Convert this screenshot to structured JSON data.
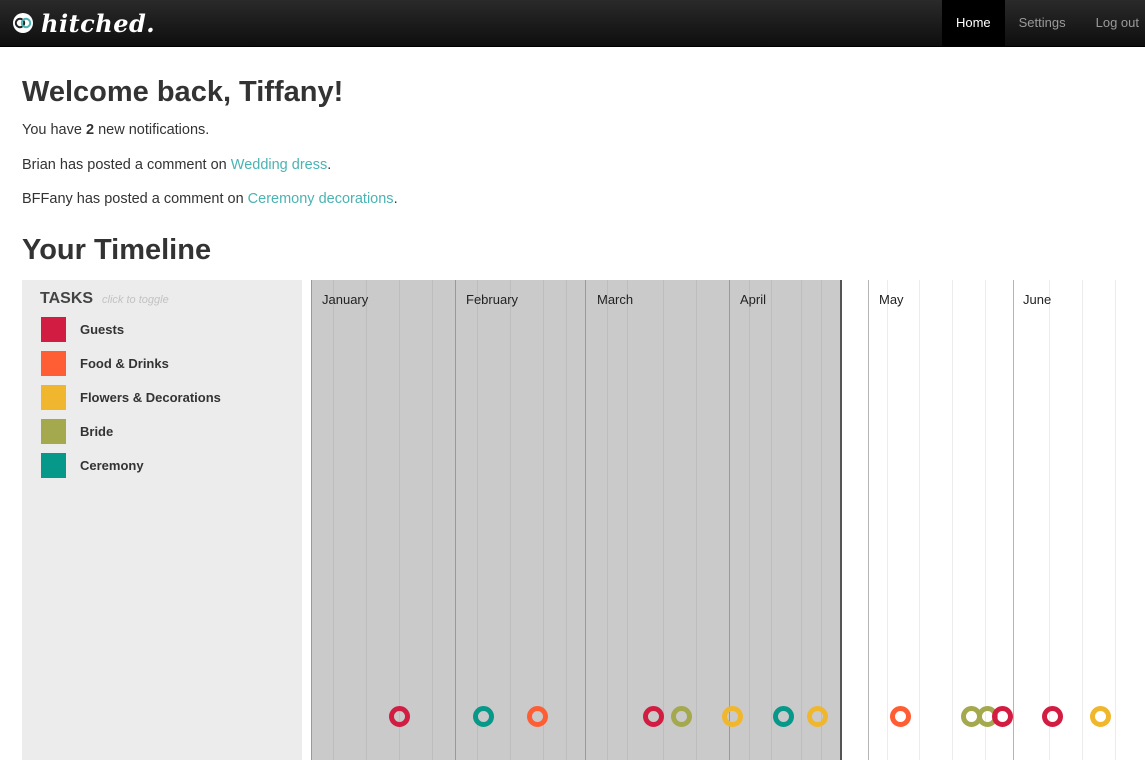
{
  "nav": {
    "brand": "hitched.",
    "links": [
      {
        "label": "Home",
        "active": true
      },
      {
        "label": "Settings",
        "active": false
      },
      {
        "label": "Log out",
        "active": false
      }
    ]
  },
  "welcome": {
    "title": "Welcome back, Tiffany!",
    "notif_prefix": "You have ",
    "notif_count": "2",
    "notif_suffix": " new notifications.",
    "notifications": [
      {
        "text": "Brian has posted a comment on ",
        "link": "Wedding dress",
        "end": "."
      },
      {
        "text": "BFFany has posted a comment on ",
        "link": "Ceremony decorations",
        "end": "."
      }
    ]
  },
  "timeline": {
    "title": "Your Timeline",
    "tasks_title": "TASKS",
    "tasks_hint": "click to toggle",
    "categories": [
      {
        "label": "Guests",
        "color": "#d21c42"
      },
      {
        "label": "Food & Drinks",
        "color": "#ff5e35"
      },
      {
        "label": "Flowers & Decorations",
        "color": "#f0b72e"
      },
      {
        "label": "Bride",
        "color": "#a4a94d"
      },
      {
        "label": "Ceremony",
        "color": "#069889"
      }
    ],
    "months": [
      "January",
      "February",
      "March",
      "April",
      "May",
      "June"
    ],
    "task_markers": [
      {
        "category": "Guests"
      },
      {
        "category": "Ceremony"
      },
      {
        "category": "Food & Drinks"
      },
      {
        "category": "Guests"
      },
      {
        "category": "Bride"
      },
      {
        "category": "Flowers & Decorations"
      },
      {
        "category": "Ceremony"
      },
      {
        "category": "Flowers & Decorations"
      },
      {
        "category": "Food & Drinks"
      },
      {
        "category": "Bride"
      },
      {
        "category": "Bride"
      },
      {
        "category": "Guests"
      },
      {
        "category": "Guests"
      },
      {
        "category": "Flowers & Decorations"
      }
    ]
  }
}
